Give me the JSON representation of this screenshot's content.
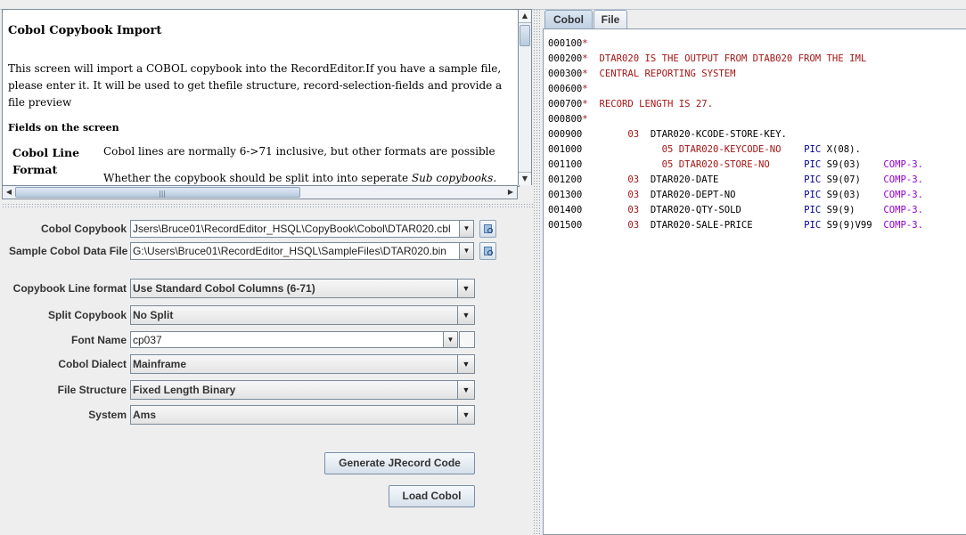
{
  "help": {
    "title": "Cobol Copybook Import",
    "intro": "This screen will import a COBOL copybook into the RecordEditor.If you have a sample file, please enter it. It will be used to get thefile structure, record-selection-fields and provide a file preview",
    "fields_heading": "Fields on the screen",
    "term1": "Cobol Line Format",
    "desc1": "Cobol lines are normally 6->71 inclusive, but other formats are possible",
    "desc2_plain": "Whether the copybook should be split into into seperate ",
    "desc2_italic": "Sub copybooks. See"
  },
  "form": {
    "cobol_copybook_label": "Cobol Copybook",
    "cobol_copybook_value": "Jsers\\Bruce01\\RecordEditor_HSQL\\CopyBook\\Cobol\\DTAR020.cbl",
    "sample_file_label": "Sample Cobol Data File",
    "sample_file_value": "G:\\Users\\Bruce01\\RecordEditor_HSQL\\SampleFiles\\DTAR020.bin",
    "line_format_label": "Copybook Line format",
    "line_format_value": "Use Standard Cobol Columns (6-71)",
    "split_label": "Split Copybook",
    "split_value": "No Split",
    "font_label": "Font Name",
    "font_value": "cp037",
    "dialect_label": "Cobol Dialect",
    "dialect_value": "Mainframe",
    "structure_label": "File Structure",
    "structure_value": "Fixed Length Binary",
    "system_label": "System",
    "system_value": "Ams",
    "generate_button": "Generate JRecord Code",
    "load_button": "Load Cobol"
  },
  "tabs": {
    "cobol": "Cobol",
    "file": "File"
  },
  "code_lines": [
    {
      "num": "000100*",
      "level": "",
      "text": "",
      "pic": "",
      "picval": "",
      "comp": ""
    },
    {
      "num": "000200*",
      "level": "",
      "text": "DTAR020 IS THE OUTPUT FROM DTAB020 FROM THE IML",
      "pic": "",
      "picval": "",
      "comp": ""
    },
    {
      "num": "000300*",
      "level": "",
      "text": "CENTRAL REPORTING SYSTEM",
      "pic": "",
      "picval": "",
      "comp": ""
    },
    {
      "num": "000600*",
      "level": "",
      "text": "",
      "pic": "",
      "picval": "",
      "comp": ""
    },
    {
      "num": "000700*",
      "level": "",
      "text": "RECORD LENGTH IS 27.",
      "pic": "",
      "picval": "",
      "comp": ""
    },
    {
      "num": "000800*",
      "level": "",
      "text": "",
      "pic": "",
      "picval": "",
      "comp": ""
    },
    {
      "num": "000900",
      "level": "03",
      "text": "DTAR020-KCODE-STORE-KEY.",
      "pic": "",
      "picval": "",
      "comp": ""
    },
    {
      "num": "001000",
      "level": "05",
      "text": "DTAR020-KEYCODE-NO",
      "pic": "PIC",
      "picval": "X(08).",
      "comp": ""
    },
    {
      "num": "001100",
      "level": "05",
      "text": "DTAR020-STORE-NO",
      "pic": "PIC",
      "picval": "S9(03)",
      "comp": "COMP-3."
    },
    {
      "num": "001200",
      "level": "03",
      "text": "DTAR020-DATE",
      "pic": "PIC",
      "picval": "S9(07)",
      "comp": "COMP-3."
    },
    {
      "num": "001300",
      "level": "03",
      "text": "DTAR020-DEPT-NO",
      "pic": "PIC",
      "picval": "S9(03)",
      "comp": "COMP-3."
    },
    {
      "num": "001400",
      "level": "03",
      "text": "DTAR020-QTY-SOLD",
      "pic": "PIC",
      "picval": "S9(9)",
      "comp": "COMP-3."
    },
    {
      "num": "001500",
      "level": "03",
      "text": "DTAR020-SALE-PRICE",
      "pic": "PIC",
      "picval": "S9(9)V99",
      "comp": "COMP-3."
    }
  ]
}
